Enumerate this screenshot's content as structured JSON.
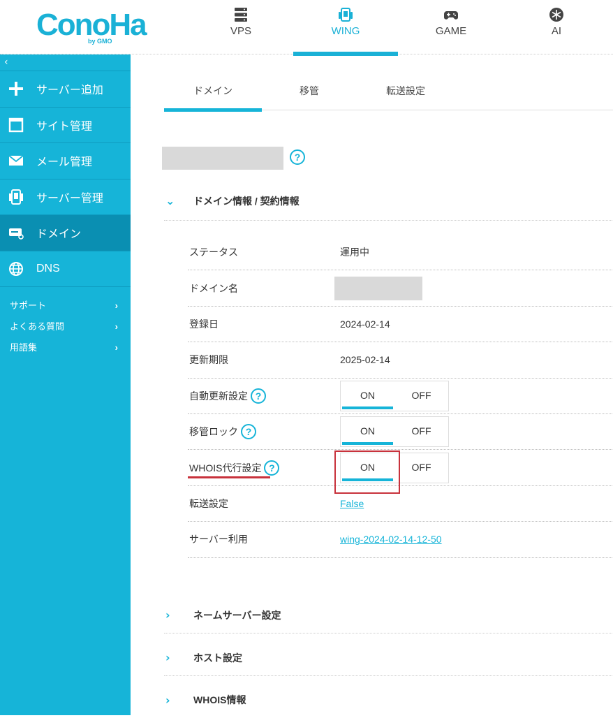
{
  "header": {
    "logo_text": "ConoHa",
    "logo_sub": "by GMO",
    "nav": [
      {
        "label": "VPS",
        "icon": "server-icon"
      },
      {
        "label": "WING",
        "icon": "tablet-icon"
      },
      {
        "label": "GAME",
        "icon": "gamepad-icon"
      },
      {
        "label": "AI",
        "icon": "ai-icon"
      }
    ],
    "active_nav": "WING"
  },
  "sidebar": {
    "collapse_glyph": "‹",
    "items": [
      {
        "label": "サーバー追加",
        "icon": "plus-icon"
      },
      {
        "label": "サイト管理",
        "icon": "window-icon"
      },
      {
        "label": "メール管理",
        "icon": "mail-icon"
      },
      {
        "label": "サーバー管理",
        "icon": "server-manage-icon"
      },
      {
        "label": "ドメイン",
        "icon": "domain-icon"
      },
      {
        "label": "DNS",
        "icon": "globe-icon"
      }
    ],
    "active_item": "ドメイン",
    "links": [
      {
        "label": "サポート",
        "arrow": "›"
      },
      {
        "label": "よくある質問",
        "arrow": "›"
      },
      {
        "label": "用語集",
        "arrow": "›"
      }
    ]
  },
  "tabs": [
    {
      "label": "ドメイン"
    },
    {
      "label": "移管"
    },
    {
      "label": "転送設定"
    }
  ],
  "active_tab": "ドメイン",
  "section_domain_info": {
    "title": "ドメイン情報 / 契約情報",
    "chevron": "⌄"
  },
  "info": {
    "status": {
      "label": "ステータス",
      "value": "運用中"
    },
    "domain_name": {
      "label": "ドメイン名"
    },
    "registered": {
      "label": "登録日",
      "value": "2024-02-14"
    },
    "renewal": {
      "label": "更新期限",
      "value": "2025-02-14"
    },
    "auto_renew": {
      "label": "自動更新設定",
      "on": "ON",
      "off": "OFF"
    },
    "transfer_lock": {
      "label": "移管ロック",
      "on": "ON",
      "off": "OFF"
    },
    "whois_proxy": {
      "label": "WHOIS代行設定",
      "on": "ON",
      "off": "OFF"
    },
    "forwarding": {
      "label": "転送設定",
      "value": "False"
    },
    "server_use": {
      "label": "サーバー利用",
      "value": "wing-2024-02-14-12-50"
    }
  },
  "help_glyph": "?",
  "collapsed_sections": [
    {
      "title": "ネームサーバー設定",
      "chevron": "›"
    },
    {
      "title": "ホスト設定",
      "chevron": "›"
    },
    {
      "title": "WHOIS情報",
      "chevron": "›"
    }
  ],
  "colors": {
    "accent": "#16b4d8",
    "highlight": "#c8323c"
  }
}
